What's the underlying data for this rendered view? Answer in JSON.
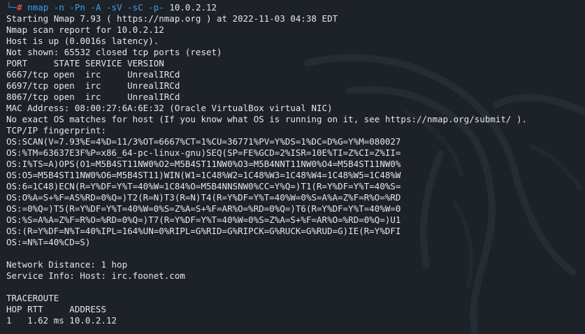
{
  "prompt": {
    "corner": "└─",
    "symbol": "#",
    "command": "nmap",
    "options": "-n -Pn -A -sV -sC -p-",
    "target": "10.0.2.12"
  },
  "output_lines": [
    "Starting Nmap 7.93 ( https://nmap.org ) at 2022-11-03 04:38 EDT",
    "Nmap scan report for 10.0.2.12",
    "Host is up (0.0016s latency).",
    "Not shown: 65532 closed tcp ports (reset)",
    "PORT     STATE SERVICE VERSION",
    "6667/tcp open  irc     UnrealIRCd",
    "6697/tcp open  irc     UnrealIRCd",
    "8067/tcp open  irc     UnrealIRCd",
    "MAC Address: 08:00:27:6A:6E:32 (Oracle VirtualBox virtual NIC)",
    "No exact OS matches for host (If you know what OS is running on it, see https://nmap.org/submit/ ).",
    "TCP/IP fingerprint:",
    "OS:SCAN(V=7.93%E=4%D=11/3%OT=6667%CT=1%CU=36771%PV=Y%DS=1%DC=D%G=Y%M=080027",
    "OS:%TM=63637E3F%P=x86_64-pc-linux-gnu)SEQ(SP=FE%GCD=2%ISR=10E%TI=Z%CI=Z%II=",
    "OS:I%TS=A)OPS(O1=M5B4ST11NW0%O2=M5B4ST11NW0%O3=M5B4NNT11NW0%O4=M5B4ST11NW0%",
    "OS:O5=M5B4ST11NW0%O6=M5B4ST11)WIN(W1=1C48%W2=1C48%W3=1C48%W4=1C48%W5=1C48%W",
    "OS:6=1C48)ECN(R=Y%DF=Y%T=40%W=1C84%O=M5B4NNSNW0%CC=Y%Q=)T1(R=Y%DF=Y%T=40%S=",
    "OS:O%A=S+%F=AS%RD=0%Q=)T2(R=N)T3(R=N)T4(R=Y%DF=Y%T=40%W=0%S=A%A=Z%F=R%O=%RD",
    "OS:=0%Q=)T5(R=Y%DF=Y%T=40%W=0%S=Z%A=S+%F=AR%O=%RD=0%Q=)T6(R=Y%DF=Y%T=40%W=0",
    "OS:%S=A%A=Z%F=R%O=%RD=0%Q=)T7(R=Y%DF=Y%T=40%W=0%S=Z%A=S+%F=AR%O=%RD=0%Q=)U1",
    "OS:(R=Y%DF=N%T=40%IPL=164%UN=0%RIPL=G%RID=G%RIPCK=G%RUCK=G%RUD=G)IE(R=Y%DFI",
    "OS:=N%T=40%CD=S)",
    "",
    "Network Distance: 1 hop",
    "Service Info: Host: irc.foonet.com",
    "",
    "TRACEROUTE",
    "HOP RTT     ADDRESS",
    "1   1.62 ms 10.0.2.12"
  ],
  "colors": {
    "background": "#1d2229",
    "text": "#e6e6e6",
    "prompt_accent": "#2a8bdc",
    "prompt_symbol": "#e8433b"
  },
  "background_logo": "kali-dragon-icon"
}
